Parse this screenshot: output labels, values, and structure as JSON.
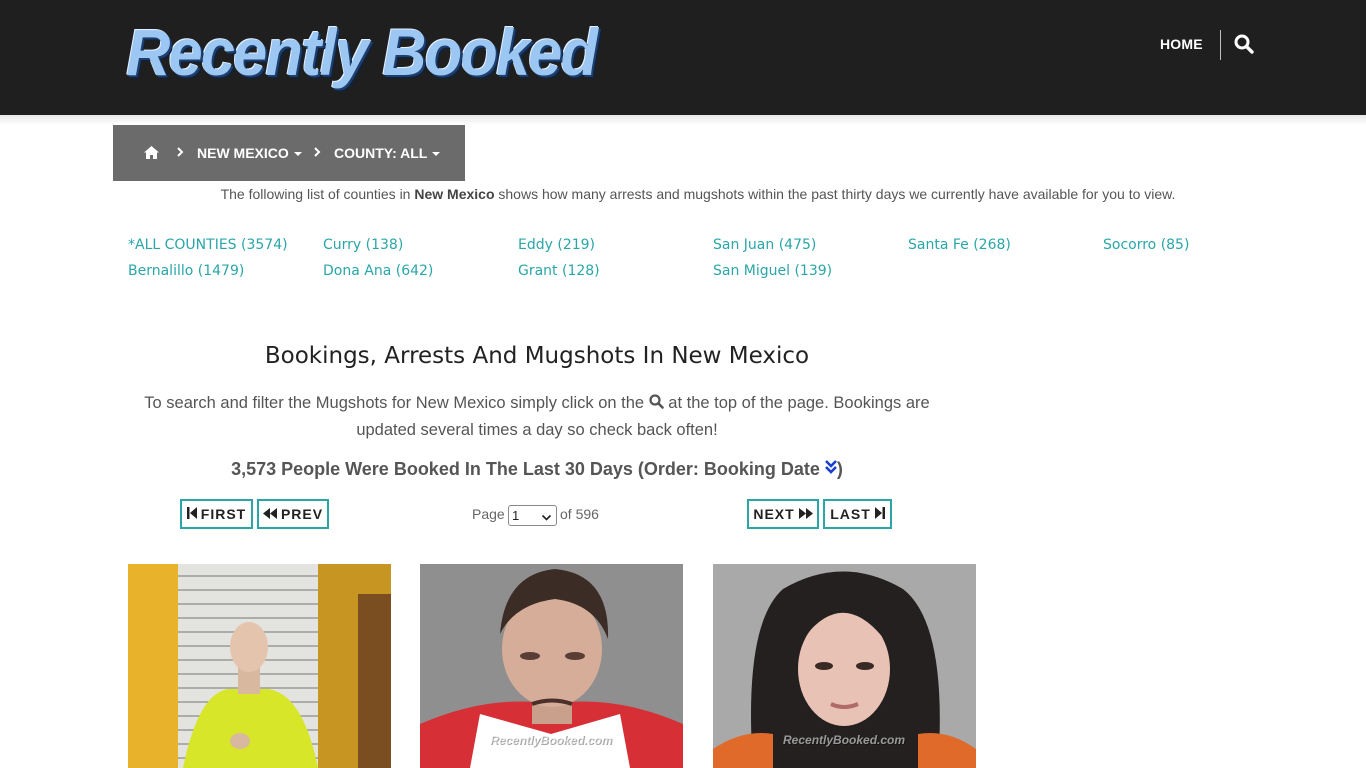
{
  "header": {
    "logo_text": "Recently Booked",
    "nav_home": "HOME",
    "search_icon": "search-icon"
  },
  "breadcrumb": {
    "home_icon": "home-icon",
    "state": "NEW MEXICO",
    "county": "COUNTY: ALL"
  },
  "intro": {
    "before": "The following list of counties in ",
    "state": "New Mexico",
    "after": " shows how many arrests and mugshots within the past thirty days we currently have available for you to view."
  },
  "counties": [
    "*ALL COUNTIES (3574)",
    "Curry (138)",
    "Eddy (219)",
    "San Juan (475)",
    "Santa Fe (268)",
    "Socorro (85)",
    "Bernalillo (1479)",
    "Dona Ana (642)",
    "Grant (128)",
    "San Miguel (139)"
  ],
  "main": {
    "title": "Bookings, Arrests And Mugshots In New Mexico",
    "instructions_before": "To search and filter the Mugshots for New Mexico simply click on the",
    "instructions_after": "at the top of the page. Bookings are updated several times a day so check back often!",
    "count_text": "3,573 People Were Booked In The Last 30 Days (Order: Booking Date",
    "count_close": ")",
    "order_icon": "double-chevron-down-icon"
  },
  "pagination": {
    "first": "FIRST",
    "prev": "PREV",
    "next": "NEXT",
    "last": "LAST",
    "page_label": "Page",
    "current_page": "1",
    "of_label": "of 596"
  },
  "mugshots": {
    "watermark": "RecentlyBooked.com"
  },
  "colors": {
    "header_bg": "#1f1f1f",
    "breadcrumb_bg": "#6b6b6b",
    "accent": "#2aa6a8",
    "order_icon": "#1a3fcf"
  }
}
